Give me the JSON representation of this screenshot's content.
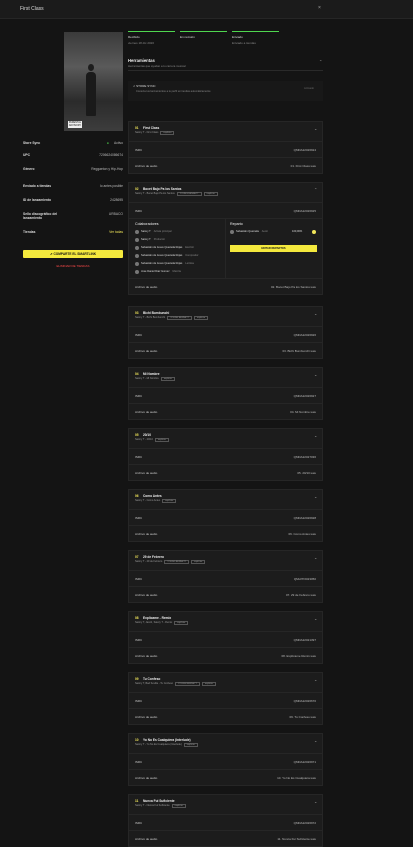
{
  "window": {
    "title": "First Class",
    "close": "×"
  },
  "release": {
    "cover_logo": "PARENTAL ADVISORY EXPLICIT CONTENT",
    "meta": [
      {
        "key": "Store Sync",
        "value": "Activo"
      },
      {
        "key": "UPC",
        "value": "7206624086674"
      },
      {
        "key": "Género",
        "value": "Reggaeton y Hip-Hop"
      },
      {
        "key": "Enviado a tiendas",
        "value": "lo antes posible"
      },
      {
        "key": "ID de lanzamiento",
        "value": "2428695"
      },
      {
        "key": "Sello discográfico del lanzamiento",
        "value": "URBACO"
      },
      {
        "key": "Tiendas",
        "value": "Ver todas"
      }
    ],
    "share_button": "COMPARTE EL SMARTLINK",
    "delete_link": "ELIMINAR DE TIENDAS"
  },
  "steps": [
    {
      "title": "Recibido",
      "sub": "viernes 18 dic 2020"
    },
    {
      "title": "En revisión",
      "sub": ""
    },
    {
      "title": "Enviado",
      "sub": "Enviado a tiendas"
    }
  ],
  "tools": {
    "title": "Herramientas",
    "subtitle": "Herramientas que ayudan a tu carrera musical",
    "sync_title": "STORE SYNC",
    "sync_sub": "Conecta tus lanzamientos a tu perfil en tiendas automáticamente",
    "sync_status": "Activado"
  },
  "labels": {
    "isrc": "ISRC",
    "audio": "Archivo de audio",
    "collab": "Colaboradores",
    "splits": "Reparto",
    "edit_splits": "EDITAR REPARTOS"
  },
  "tracks": [
    {
      "num": "01",
      "name": "First Class",
      "sub": "Satory T - First Class",
      "tags": [
        "explícito"
      ],
      "isrc": "QMDA22026924",
      "audio": "01. First Class.wav"
    },
    {
      "num": "02",
      "name": "Bocet Bajo Pa los Santos",
      "sub": "Satory T - Bocet Bajo Pa los Santos",
      "tags": [
        "YOUNG BENNETT",
        "explícito"
      ],
      "isrc": "QMDA22026925",
      "audio": "02. Bocet Bajo Pa los Santos.wav",
      "collaborators": [
        {
          "name": "Satory T",
          "role": "Artista principal"
        },
        {
          "name": "Satory T",
          "role": "Productor"
        },
        {
          "name": "Sebastián de Jesus Quezada Rojas",
          "role": "Escritor"
        },
        {
          "name": "Sebastián de Jesus Quezada Rojas",
          "role": "Compositor"
        },
        {
          "name": "Sebastián de Jesus Quezada Rojas",
          "role": "Letrista"
        },
        {
          "name": "Jose Daniel Diaz Gomez",
          "role": "Mezcla"
        }
      ],
      "splits": [
        {
          "name": "Sebastián Quezada",
          "role": "Autor",
          "share": "100,00%"
        }
      ]
    },
    {
      "num": "03",
      "name": "Bichi Bumbunchi",
      "sub": "Satory T - Bichi Bumbunchi",
      "tags": [
        "YOUNG BENNETT",
        "explícito"
      ],
      "isrc": "QMDA22026926",
      "audio": "03. Bichi Bumbunchi.wav"
    },
    {
      "num": "04",
      "name": "Mi Nombre",
      "sub": "Satory T - Mi Nombre",
      "tags": [
        "explícito"
      ],
      "isrc": "QMDA22026927",
      "audio": "04. Mi Nombre.wav"
    },
    {
      "num": "05",
      "name": "20/10",
      "sub": "Satory T - 20/10",
      "tags": [
        "explícito"
      ],
      "isrc": "QMDA22027036",
      "audio": "05. 20/10.wav"
    },
    {
      "num": "06",
      "name": "Como Antes",
      "sub": "Satory T - Como Antes",
      "tags": [
        "explícito"
      ],
      "isrc": "QMDA22026928",
      "audio": "06. Como Antes.wav"
    },
    {
      "num": "07",
      "name": "29 de Febrero",
      "sub": "Satory T - 29 de Febrero",
      "tags": [
        "YOUNG BENNETT",
        "explícito"
      ],
      "isrc": "QMLPP2023050",
      "audio": "07. 29 de Febrero.wav"
    },
    {
      "num": "08",
      "name": "Explícame - Remix",
      "sub": "Satory T, Jacob, Satory T - Remix",
      "tags": [
        "explícito"
      ],
      "isrc": "QMDA22021397",
      "audio": "08. Explícame Remix.wav"
    },
    {
      "num": "09",
      "name": "Tu Confeso",
      "sub": "Satory T, Bad Sevilla - Tu Confeso",
      "tags": [
        "YOUNG BENNETT",
        "explícito"
      ],
      "isrc": "QMDA22026670",
      "audio": "09. Tu Confeso.wav"
    },
    {
      "num": "10",
      "name": "Yo No Es Cualquiera (Interlude)",
      "sub": "Satory T - Yo No Es Cualquiera (Interlude)",
      "tags": [
        "explícito"
      ],
      "isrc": "QMDA22026971",
      "audio": "10. Yo No Es Cualquiera.wav"
    },
    {
      "num": "11",
      "name": "Nunca Fui Suficiente",
      "sub": "Satory T - Nunca Fui Suficiente",
      "tags": [
        "explícito"
      ],
      "isrc": "QMDA22026972",
      "audio": "11. Nunca Fui Suficiente.wav"
    }
  ]
}
